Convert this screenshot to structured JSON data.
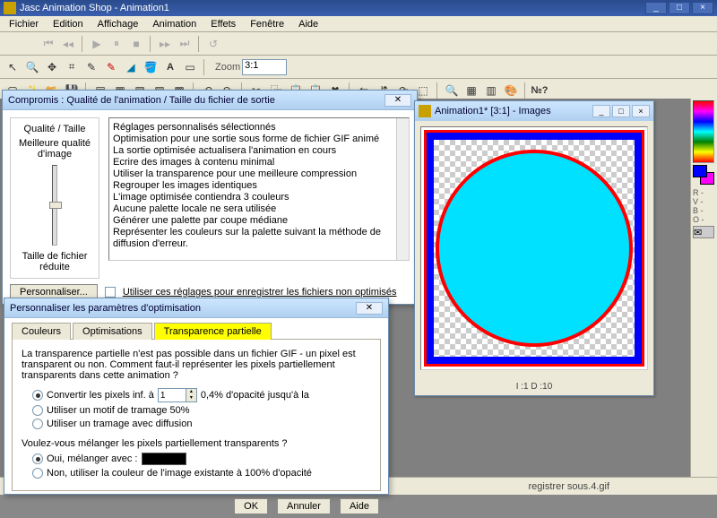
{
  "app": {
    "title": "Jasc Animation Shop - Animation1"
  },
  "menus": [
    "Fichier",
    "Edition",
    "Affichage",
    "Animation",
    "Effets",
    "Fenêtre",
    "Aide"
  ],
  "zoom": {
    "label": "Zoom",
    "value": "3:1"
  },
  "dlg_compromise": {
    "title": "Compromis : Qualité de l'animation / Taille du fichier de sortie",
    "quality_label": "Qualité / Taille",
    "best_label": "Meilleure qualité d'image",
    "worst_label": "Taille de fichier réduite",
    "customize_btn": "Personnaliser...",
    "list": [
      "Réglages personnalisés sélectionnés",
      "Optimisation pour une sortie sous forme de fichier GIF animé",
      "La sortie optimisée actualisera l'animation en cours",
      "Ecrire des images à contenu minimal",
      "Utiliser la transparence pour une meilleure compression",
      "Regrouper les images identiques",
      "",
      "L'image optimisée contiendra 3 couleurs",
      "Aucune palette locale ne sera utilisée",
      "Générer une palette par coupe médiane",
      "Représenter les couleurs sur la palette suivant la méthode de diffusion d'erreur."
    ],
    "save_chk": "Utiliser ces réglages pour enregistrer les fichiers non optimisés"
  },
  "dlg_custom": {
    "title": "Personnaliser les paramètres d'optimisation",
    "tabs": {
      "colors": "Couleurs",
      "opts": "Optimisations",
      "partial": "Transparence partielle"
    },
    "intro": "La transparence partielle n'est pas possible dans un fichier GIF - un pixel est transparent ou non. Comment faut-il représenter les pixels partiellement transparents dans cette animation ?",
    "r_convert": "Convertir les pixels inf. à",
    "spin_val": "1",
    "pct": "0,4% d'opacité jusqu'à la",
    "r_pattern": "Utiliser un motif de tramage 50%",
    "r_dither": "Utiliser un tramage avec diffusion",
    "q2": "Voulez-vous mélanger les pixels partiellement transparents ?",
    "r_blend": "Oui, mélanger avec :",
    "r_noblend": "Non, utiliser la couleur de l'image existante à 100% d'opacité",
    "ok": "OK",
    "cancel": "Annuler",
    "help": "Aide"
  },
  "child": {
    "title": "Animation1* [3:1] - Images",
    "frame_info": "I :1   D :10"
  },
  "palette": {
    "chars": "R -\nV -\nB -\nO -"
  },
  "status": {
    "filename": "registrer sous.4.gif"
  }
}
